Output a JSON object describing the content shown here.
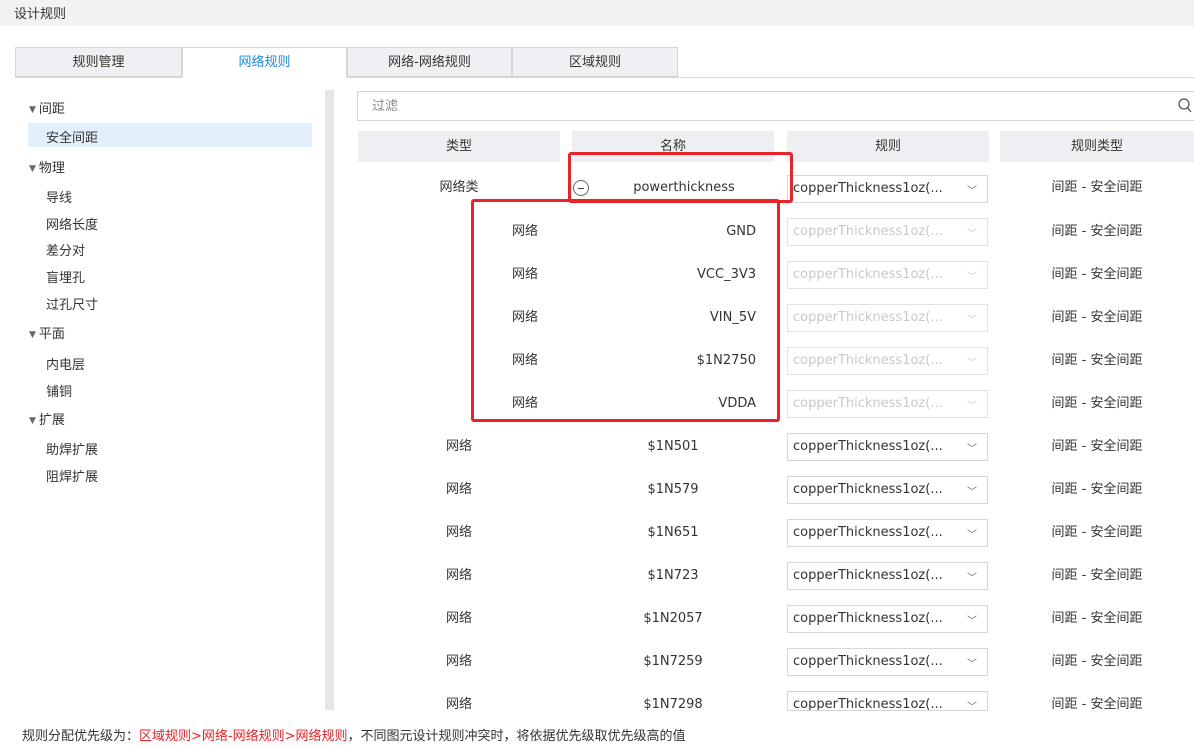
{
  "window": {
    "title": "设计规则"
  },
  "tabs": [
    {
      "label": "规则管理",
      "active": false
    },
    {
      "label": "网络规则",
      "active": true
    },
    {
      "label": "网络-网络规则",
      "active": false
    },
    {
      "label": "区域规则",
      "active": false
    }
  ],
  "sidebar": {
    "groups": [
      {
        "label": "间距",
        "items": [
          "安全间距"
        ]
      },
      {
        "label": "物理",
        "items": [
          "导线",
          "网络长度",
          "差分对",
          "盲埋孔",
          "过孔尺寸"
        ]
      },
      {
        "label": "平面",
        "items": [
          "内电层",
          "铺铜"
        ]
      },
      {
        "label": "扩展",
        "items": [
          "助焊扩展",
          "阻焊扩展"
        ]
      }
    ],
    "selected": "安全间距"
  },
  "filter": {
    "placeholder": "过滤",
    "icon": "search-icon"
  },
  "table": {
    "headers": [
      "类型",
      "名称",
      "规则",
      "规则类型"
    ],
    "rows": [
      {
        "type": "网络类",
        "name": "powerthickness",
        "rule": "copperThickness1oz(...",
        "rule_type": "间距 - 安全间距",
        "expanded": true
      },
      {
        "type": "网络",
        "name": "GND",
        "rule": "copperThickness1oz(...",
        "rule_type": "间距 - 安全间距",
        "child": true
      },
      {
        "type": "网络",
        "name": "VCC_3V3",
        "rule": "copperThickness1oz(...",
        "rule_type": "间距 - 安全间距",
        "child": true
      },
      {
        "type": "网络",
        "name": "VIN_5V",
        "rule": "copperThickness1oz(...",
        "rule_type": "间距 - 安全间距",
        "child": true
      },
      {
        "type": "网络",
        "name": "$1N2750",
        "rule": "copperThickness1oz(...",
        "rule_type": "间距 - 安全间距",
        "child": true
      },
      {
        "type": "网络",
        "name": "VDDA",
        "rule": "copperThickness1oz(...",
        "rule_type": "间距 - 安全间距",
        "child": true
      },
      {
        "type": "网络",
        "name": "$1N501",
        "rule": "copperThickness1oz(...",
        "rule_type": "间距 - 安全间距"
      },
      {
        "type": "网络",
        "name": "$1N579",
        "rule": "copperThickness1oz(...",
        "rule_type": "间距 - 安全间距"
      },
      {
        "type": "网络",
        "name": "$1N651",
        "rule": "copperThickness1oz(...",
        "rule_type": "间距 - 安全间距"
      },
      {
        "type": "网络",
        "name": "$1N723",
        "rule": "copperThickness1oz(...",
        "rule_type": "间距 - 安全间距"
      },
      {
        "type": "网络",
        "name": "$1N2057",
        "rule": "copperThickness1oz(...",
        "rule_type": "间距 - 安全间距"
      },
      {
        "type": "网络",
        "name": "$1N7259",
        "rule": "copperThickness1oz(...",
        "rule_type": "间距 - 安全间距"
      },
      {
        "type": "网络",
        "name": "$1N7298",
        "rule": "copperThickness1oz(...",
        "rule_type": "间距 - 安全间距"
      }
    ]
  },
  "footer": {
    "prefix": "规则分配优先级为：",
    "priority": "区域规则>网络-网络规则>网络规则",
    "suffix": "，不同图元设计规则冲突时，将依据优先级取优先级高的值"
  },
  "colors": {
    "accent": "#1e88e5",
    "highlight": "#e8232a",
    "selected_bg": "#e3effb"
  }
}
